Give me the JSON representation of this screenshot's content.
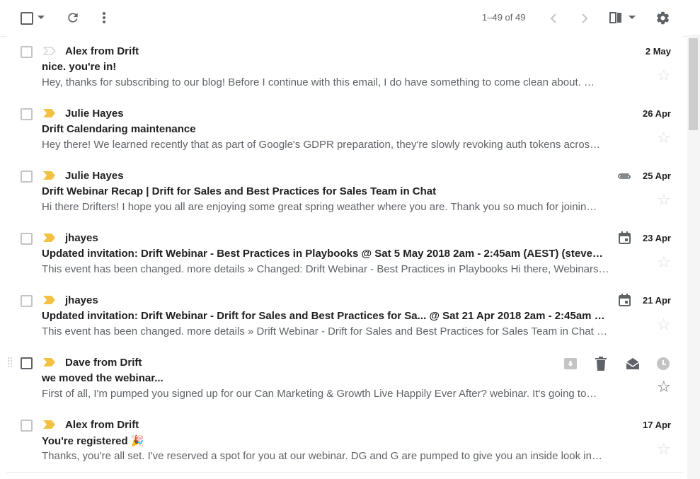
{
  "toolbar": {
    "select_icon": "checkbox-icon",
    "select_menu_icon": "caret-down-icon",
    "refresh_icon": "refresh-icon",
    "more_icon": "more-vert-icon",
    "pager_text": "1–49 of 49",
    "prev_icon": "chevron-left-icon",
    "next_icon": "chevron-right-icon",
    "split_icon": "split-pane-icon",
    "settings_icon": "gear-icon"
  },
  "colors": {
    "important_marker": "#f4c243",
    "muted": "#5f6368",
    "divider": "#ececec"
  },
  "emails": [
    {
      "sender": "Alex from Drift",
      "subject": "nice. you're in!",
      "snippet": "Hey, thanks for subscribing to our blog! Before I continue with this email, I do have something to come clean about. …",
      "date": "2 May",
      "important": false,
      "attachment": null
    },
    {
      "sender": "Julie Hayes",
      "subject": "Drift Calendaring maintenance",
      "snippet": "Hey there! We learned recently that as part of Google's GDPR preparation, they're slowly revoking auth tokens acros…",
      "date": "26 Apr",
      "important": true,
      "attachment": null
    },
    {
      "sender": "Julie Hayes",
      "subject": "Drift Webinar Recap | Drift for Sales and Best Practices for Sales Team in Chat",
      "snippet": "Hi there Drifters! I hope you all are enjoying some great spring weather where you are. Thank you so much for joinin…",
      "date": "25 Apr",
      "important": true,
      "attachment": "paperclip-icon"
    },
    {
      "sender": "jhayes",
      "subject": "Updated invitation: Drift Webinar - Best Practices in Playbooks @ Sat 5 May 2018 2am - 2:45am (AEST) (steve…",
      "snippet": "This event has been changed. more details » Changed: Drift Webinar - Best Practices in Playbooks Hi there, Webinars…",
      "date": "23 Apr",
      "important": true,
      "attachment": "calendar-icon"
    },
    {
      "sender": "jhayes",
      "subject": "Updated invitation: Drift Webinar - Drift for Sales and Best Practices for Sa... @ Sat 21 Apr 2018 2am - 2:45am …",
      "snippet": "This event has been changed. more details » Drift Webinar - Drift for Sales and Best Practices for Sales Team in Chat …",
      "date": "21 Apr",
      "important": true,
      "attachment": "calendar-icon"
    },
    {
      "sender": "Dave from Drift",
      "subject": "we moved the webinar...",
      "snippet": "First of all, I'm pumped you signed up for our Can Marketing & Growth Live Happily Ever After? webinar. It's going to…",
      "date": "",
      "important": true,
      "hovered": true,
      "hover_actions": [
        "archive-icon",
        "trash-icon",
        "mark-read-icon",
        "snooze-icon"
      ]
    },
    {
      "sender": "Alex from Drift",
      "subject": "You're registered 🎉",
      "snippet": "Thanks, you're all set. I've reserved a spot for you at our webinar. DG and G are pumped to give you an inside look in…",
      "date": "17 Apr",
      "important": true,
      "attachment": null
    }
  ]
}
